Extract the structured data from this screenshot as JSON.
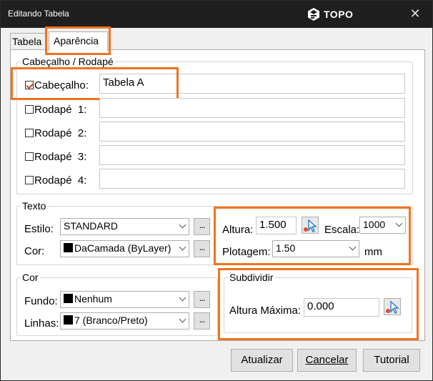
{
  "window": {
    "title": "Editando Tabela",
    "brand": "TOPO",
    "close_glyph": "✕"
  },
  "tabs": [
    {
      "label": "Tabela"
    },
    {
      "label": "Aparência",
      "active": true
    }
  ],
  "header_footer": {
    "title": "Cabeçalho / Rodapé",
    "rows": [
      {
        "label": "Cabeçalho:",
        "checked": true,
        "value": "Tabela A"
      },
      {
        "label": "Rodapé  1:",
        "checked": false,
        "value": ""
      },
      {
        "label": "Rodapé  2:",
        "checked": false,
        "value": ""
      },
      {
        "label": "Rodapé  3:",
        "checked": false,
        "value": ""
      },
      {
        "label": "Rodapé  4:",
        "checked": false,
        "value": ""
      }
    ]
  },
  "texto": {
    "title": "Texto",
    "estilo_label": "Estilo:",
    "estilo_value": "STANDARD",
    "cor_label": "Cor:",
    "cor_value": "DaCamada (ByLayer)",
    "altura_label": "Altura:",
    "altura_value": "1.500",
    "escala_label": "Escala:",
    "escala_value": "1000",
    "plotagem_label": "Plotagem:",
    "plotagem_value": "1.50",
    "unit": "mm"
  },
  "cor": {
    "title": "Cor",
    "fundo_label": "Fundo:",
    "fundo_value": "Nenhum",
    "linhas_label": "Linhas:",
    "linhas_value": "7 (Branco/Preto)"
  },
  "subdividir": {
    "title": "Subdividir",
    "altura_label": "Altura Máxima:",
    "altura_value": "0.000"
  },
  "buttons": {
    "atualizar": "Atualizar",
    "cancelar": "Cancelar",
    "tutorial": "Tutorial"
  },
  "more_glyph": "...",
  "colors": {
    "highlight": "#f2731e",
    "titlebar": "#1f1f1f",
    "check": "#d0401f"
  }
}
